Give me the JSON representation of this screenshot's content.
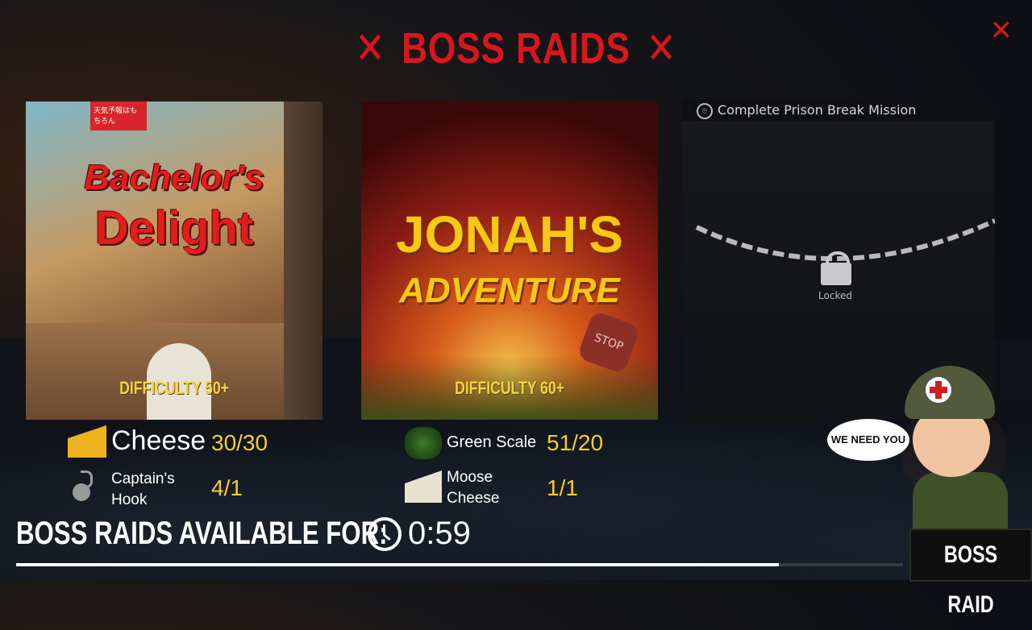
{
  "header": {
    "title": "BOSS RAIDS",
    "decor_left": "✕",
    "decor_right": "✕",
    "close": "✕"
  },
  "raids": [
    {
      "title_line1": "Bachelor's",
      "title_line2": "Delight",
      "difficulty": "DIFFICULTY 50+",
      "sign_text": "天気予報はもちろん"
    },
    {
      "title_line1": "JONAH'S",
      "title_line2": "ADVENTURE",
      "difficulty": "DIFFICULTY 60+",
      "sign_text": "STOP"
    },
    {
      "requirement": "Complete Prison Break Mission",
      "locked_label": "Locked"
    }
  ],
  "resources": [
    {
      "name": "Cheese",
      "value": "30/30",
      "icon": "cheese-icon"
    },
    {
      "name": "Captain's Hook",
      "value": "4/1",
      "icon": "hook-icon"
    },
    {
      "name": "Green Scale",
      "value": "51/20",
      "icon": "green-scale-icon"
    },
    {
      "name": "Moose Cheese",
      "value": "1/1",
      "icon": "moose-cheese-icon"
    }
  ],
  "footer": {
    "available_label": "BOSS RAIDS AVAILABLE FOR:",
    "timer": "0:59",
    "progress": 0.86
  },
  "mascot": {
    "speech": "WE NEED YOU"
  },
  "boss_raid_button": "BOSS RAID",
  "colors": {
    "title": "#d9161b",
    "value": "#f2cf2b",
    "difficulty": "#f1d34a"
  }
}
